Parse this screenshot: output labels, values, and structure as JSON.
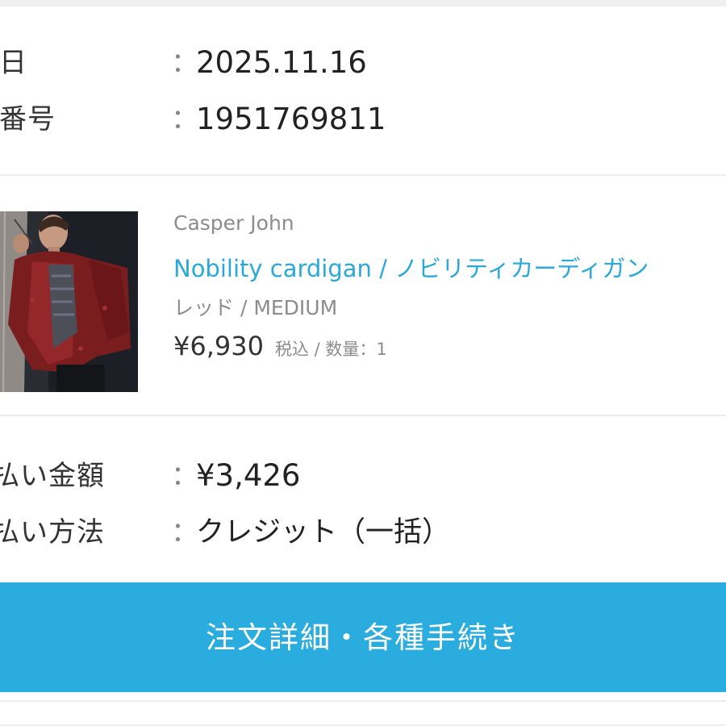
{
  "order": {
    "date_label": "文日",
    "date_value": "2025.11.16",
    "number_label": "文番号",
    "number_value": "1951769811",
    "colon": "："
  },
  "product": {
    "brand": "Casper John",
    "name": "Nobility cardigan / ノビリティカーディガン",
    "variant": "レッド / MEDIUM",
    "price": "¥6,930",
    "price_note": "税込 / 数量：1",
    "name_color": "#29a9d9"
  },
  "payment": {
    "amount_label": "払い金額",
    "amount_value": "¥3,426",
    "method_label": "払い方法",
    "method_value": "クレジット（一括）"
  },
  "actions": {
    "detail_button_label": "注文詳細・各種手続き",
    "button_color": "#2bacdf"
  }
}
